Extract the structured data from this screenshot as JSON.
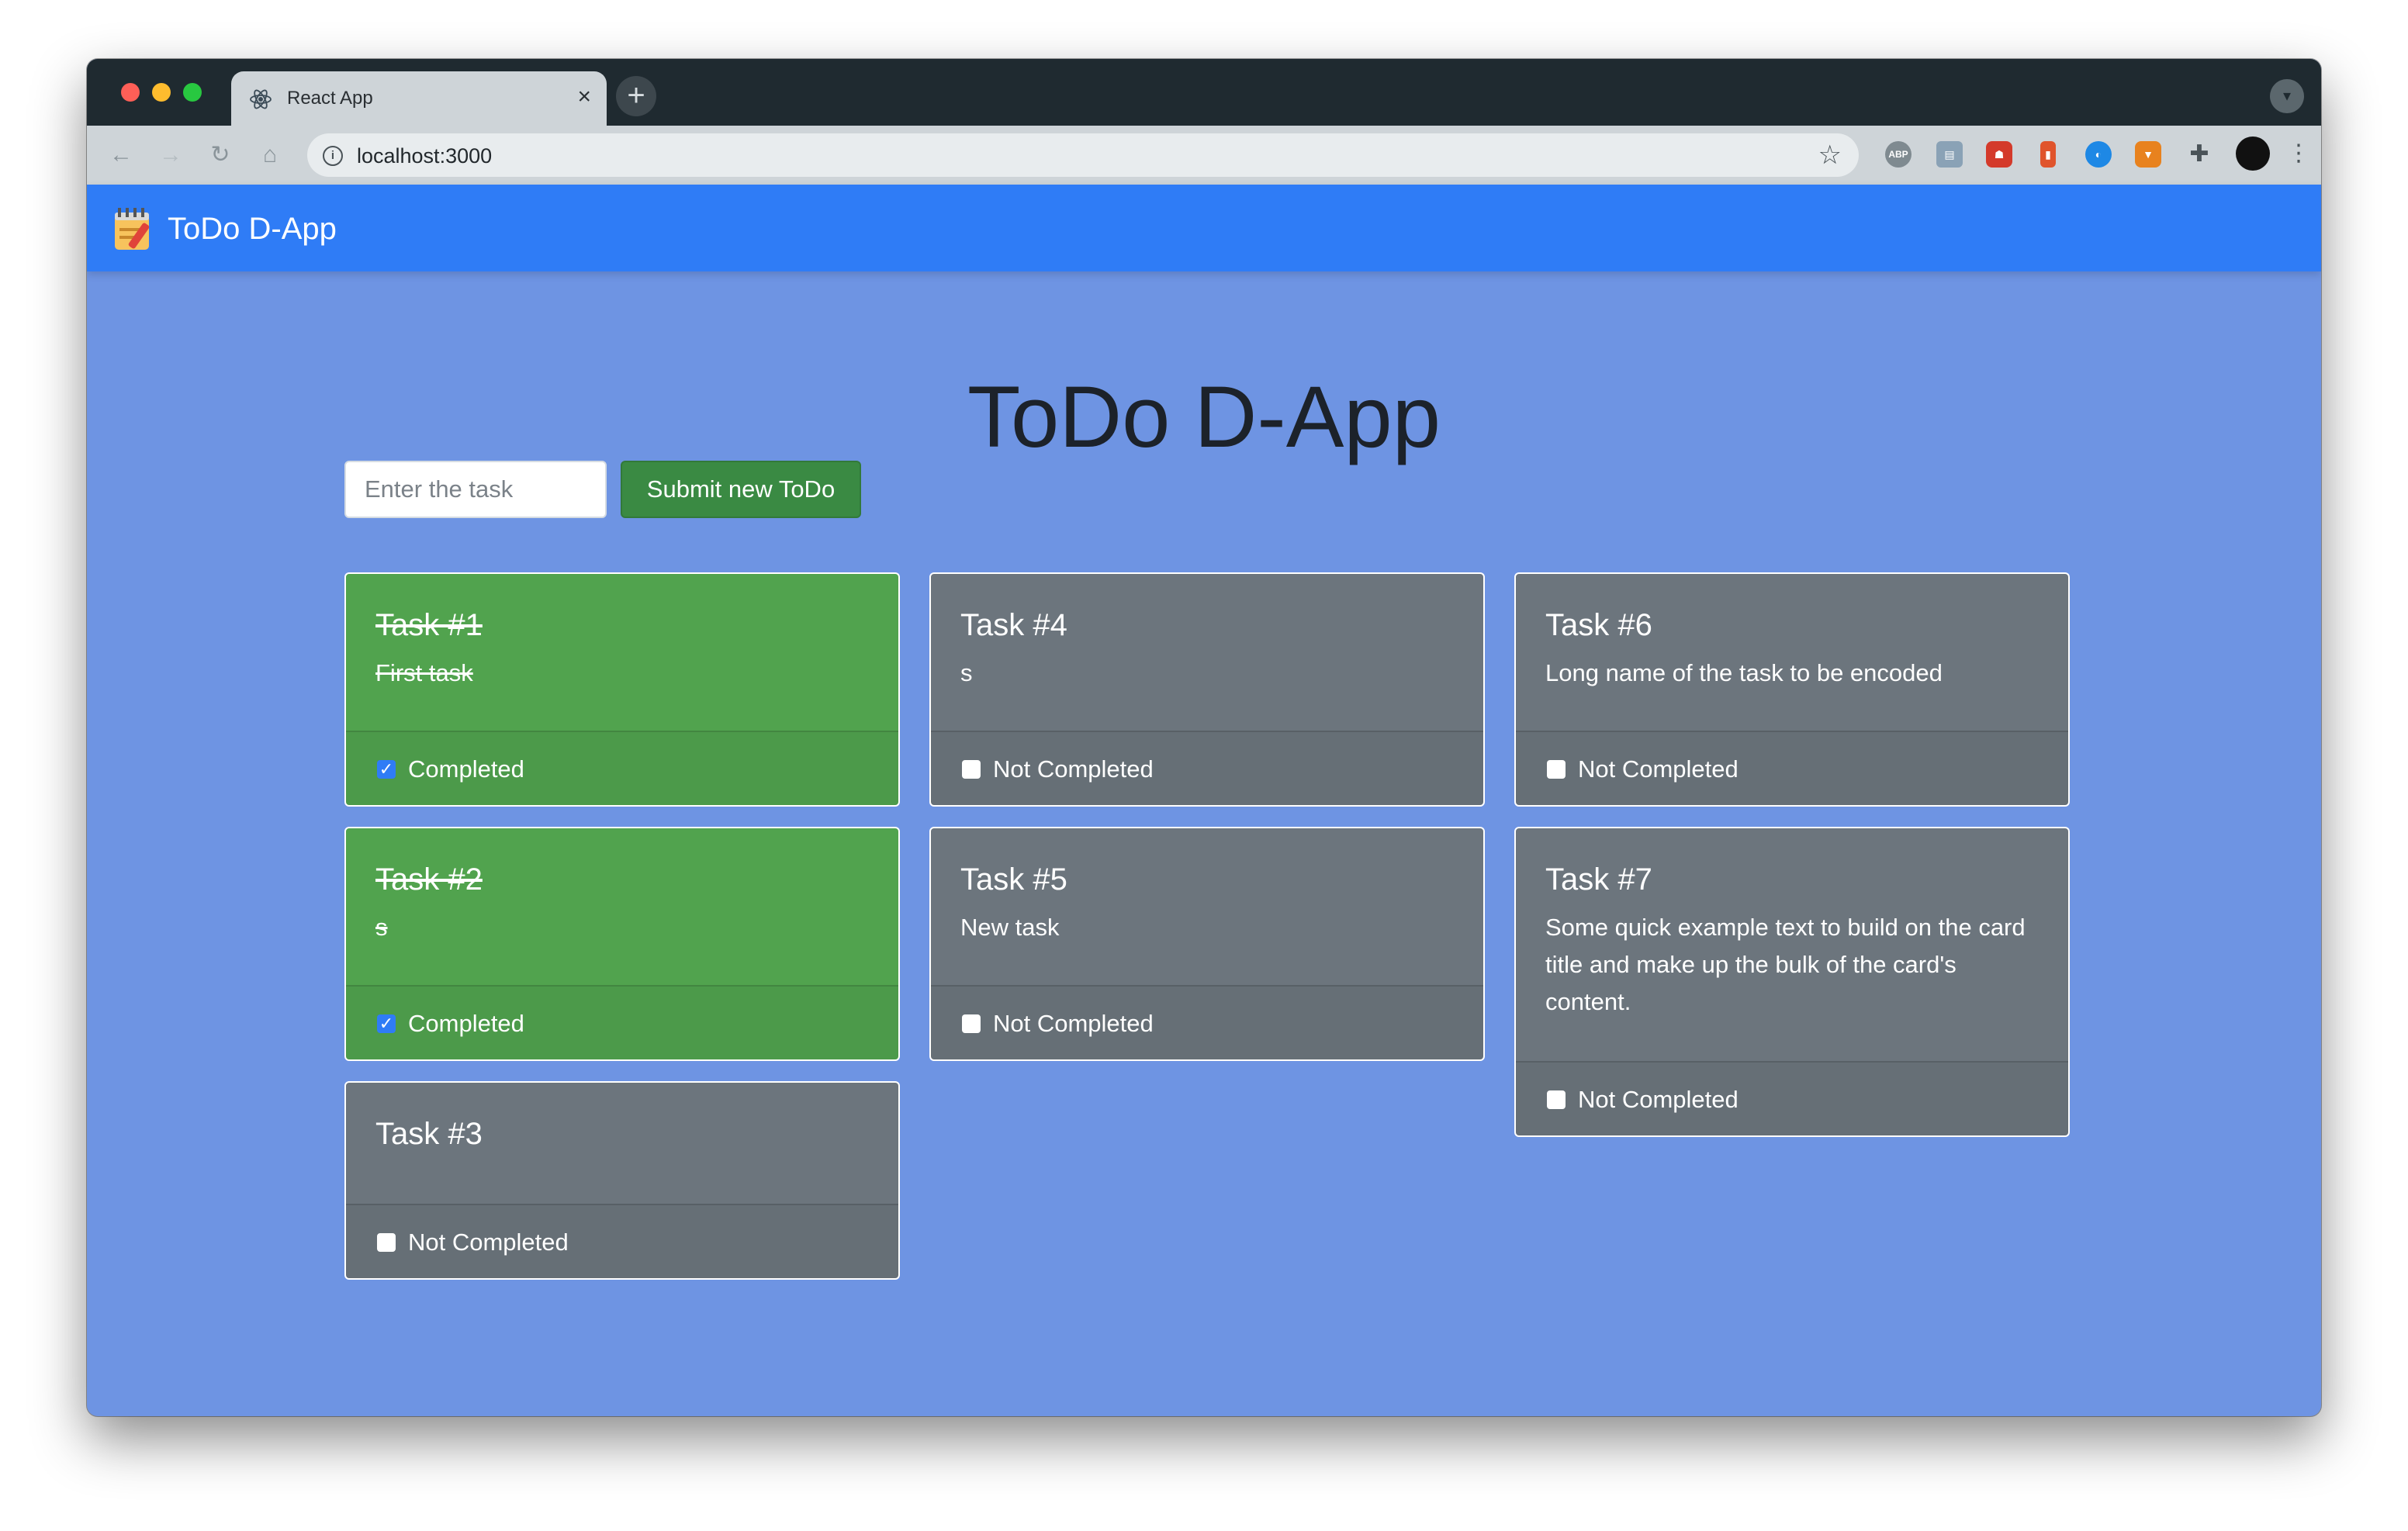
{
  "browser": {
    "tab_title": "React App",
    "tab_close": "×",
    "new_tab": "+",
    "url": "localhost:3000",
    "icons": [
      "back-arrow-icon",
      "forward-arrow-icon",
      "reload-icon",
      "home-icon",
      "info-icon",
      "star-icon",
      "extension-icons",
      "puzzle-icon",
      "profile-avatar",
      "kebab-menu-icon"
    ]
  },
  "navbar": {
    "brand": "ToDo D-App",
    "color": "#2f7cf6"
  },
  "main": {
    "title": "ToDo D-App",
    "input_placeholder": "Enter the task",
    "submit_label": "Submit new ToDo",
    "background": "#6e94e3"
  },
  "tasks": [
    {
      "title": "Task #1",
      "text": "First task",
      "status": "Completed",
      "completed": true
    },
    {
      "title": "Task #2",
      "text": "s",
      "status": "Completed",
      "completed": true
    },
    {
      "title": "Task #3",
      "text": "",
      "status": "Not Completed",
      "completed": false
    },
    {
      "title": "Task #4",
      "text": "s",
      "status": "Not Completed",
      "completed": false
    },
    {
      "title": "Task #5",
      "text": "New task",
      "status": "Not Completed",
      "completed": false
    },
    {
      "title": "Task #6",
      "text": "Long name of the task to be encoded",
      "status": "Not Completed",
      "completed": false
    },
    {
      "title": "Task #7",
      "text": "Some quick example text to build on the card title and make up the bulk of the card's content.",
      "status": "Not Completed",
      "completed": false
    }
  ],
  "colors": {
    "completed": "#51a34e",
    "not_completed": "#6c757d",
    "submit": "#3a8a43"
  }
}
